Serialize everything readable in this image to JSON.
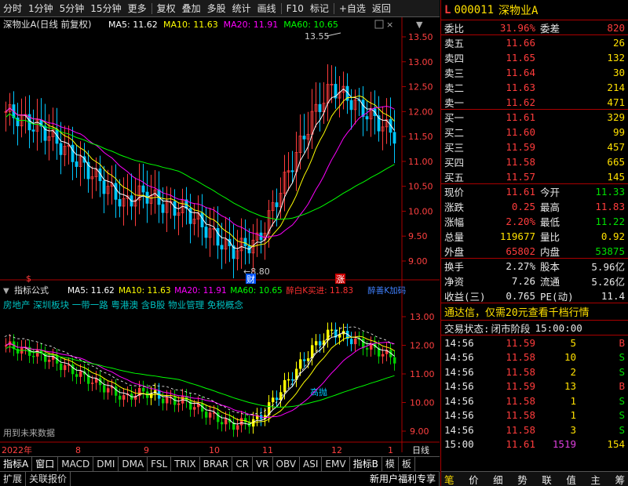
{
  "toolbar": {
    "items": [
      "分时",
      "1分钟",
      "5分钟",
      "15分钟",
      "更多",
      "复权",
      "叠加",
      "多股",
      "统计",
      "画线",
      "F10",
      "标记",
      "+自选",
      "返回"
    ]
  },
  "main_chart": {
    "title": "深物业A(日线 前复权)",
    "ma": [
      {
        "label": "MA5: 11.62",
        "color": "#ffffff"
      },
      {
        "label": "MA10: 11.63",
        "color": "#ffff00"
      },
      {
        "label": "MA20: 11.91",
        "color": "#ff00ff"
      },
      {
        "label": "MA60: 10.65",
        "color": "#00ff00"
      }
    ],
    "yticks": [
      "13.50",
      "13.00",
      "12.50",
      "12.00",
      "11.50",
      "11.00",
      "10.50",
      "10.00",
      "9.50",
      "9.00"
    ],
    "high_label": "13.55",
    "low_label": "8.80",
    "marker_cai": "财",
    "marker_zhang": "涨",
    "marker_dollar": "$"
  },
  "indicator": {
    "name": "指标公式",
    "ma": [
      {
        "label": "MA5: 11.62",
        "color": "#ffffff"
      },
      {
        "label": "MA10: 11.63",
        "color": "#ffff00"
      },
      {
        "label": "MA20: 11.91",
        "color": "#ff00ff"
      },
      {
        "label": "MA60: 10.65",
        "color": "#00ff00"
      }
    ],
    "extra1": "醉白K买进: 11.83",
    "extra2": "醉善K加码",
    "concepts": "房地产 深圳板块 一带一路 粤港澳 含B股 物业管理 免税概念",
    "note": "用到未来数据",
    "hint": "高抛",
    "yticks": [
      "13.00",
      "12.00",
      "11.00",
      "10.00",
      "9.00"
    ]
  },
  "xaxis": {
    "labels": [
      "2022年",
      "8",
      "9",
      "10",
      "11",
      "12",
      "1"
    ],
    "period": "日线"
  },
  "tabs1": [
    "指标A",
    "窗口",
    "MACD",
    "DMI",
    "DMA",
    "FSL",
    "TRIX",
    "BRAR",
    "CR",
    "VR",
    "OBV",
    "ASI",
    "EMV",
    "指标B",
    "模",
    "板"
  ],
  "tabs2": [
    "扩展",
    "关联报价",
    "新用户福利专享"
  ],
  "quote": {
    "flag": "L",
    "code": "000011",
    "name": "深物业A",
    "weibi_label": "委比",
    "weibi": "31.96%",
    "weicha_label": "委差",
    "weicha": "820",
    "sells": [
      {
        "l": "卖五",
        "p": "11.66",
        "v": "26"
      },
      {
        "l": "卖四",
        "p": "11.65",
        "v": "132"
      },
      {
        "l": "卖三",
        "p": "11.64",
        "v": "30"
      },
      {
        "l": "卖二",
        "p": "11.63",
        "v": "214"
      },
      {
        "l": "卖一",
        "p": "11.62",
        "v": "471"
      }
    ],
    "buys": [
      {
        "l": "买一",
        "p": "11.61",
        "v": "329"
      },
      {
        "l": "买二",
        "p": "11.60",
        "v": "99"
      },
      {
        "l": "买三",
        "p": "11.59",
        "v": "457"
      },
      {
        "l": "买四",
        "p": "11.58",
        "v": "665"
      },
      {
        "l": "买五",
        "p": "11.57",
        "v": "145"
      }
    ],
    "stats": [
      [
        "现价",
        "11.61",
        "今开",
        "11.33"
      ],
      [
        "涨跌",
        "0.25",
        "最高",
        "11.83"
      ],
      [
        "涨幅",
        "2.20%",
        "最低",
        "11.22"
      ],
      [
        "总量",
        "119677",
        "量比",
        "0.92"
      ],
      [
        "外盘",
        "65802",
        "内盘",
        "53875"
      ]
    ],
    "stats2": [
      [
        "换手",
        "2.27%",
        "股本",
        "5.96亿"
      ],
      [
        "净资",
        "7.26",
        "流通",
        "5.26亿"
      ],
      [
        "收益(三)",
        "0.765",
        "PE(动)",
        "11.4"
      ]
    ],
    "ad": "通达信，仅需20元查看千档行情",
    "status_label": "交易状态:",
    "status": "闭市阶段",
    "status_time": "15:00:00",
    "ticks": [
      [
        "14:56",
        "11.59",
        "5",
        "B"
      ],
      [
        "14:56",
        "11.58",
        "10",
        "S"
      ],
      [
        "14:56",
        "11.58",
        "2",
        "S"
      ],
      [
        "14:56",
        "11.59",
        "13",
        "B"
      ],
      [
        "14:56",
        "11.58",
        "1",
        "S"
      ],
      [
        "14:56",
        "11.58",
        "1",
        "S"
      ],
      [
        "14:56",
        "11.58",
        "3",
        "S"
      ],
      [
        "15:00",
        "11.61",
        "1519",
        "154"
      ]
    ],
    "bottom_icons": [
      "笔",
      "价",
      "细",
      "势",
      "联",
      "值",
      "主",
      "筹"
    ]
  }
}
